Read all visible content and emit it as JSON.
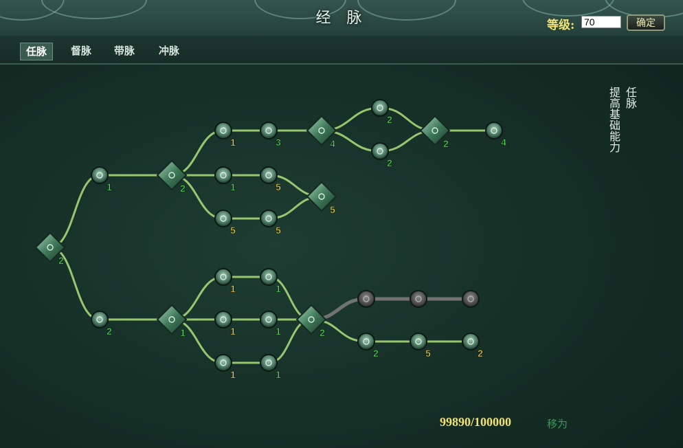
{
  "window": {
    "title": "经 脉"
  },
  "level": {
    "label": "等级:",
    "value": "70",
    "confirm": "确定"
  },
  "tabs": [
    {
      "label": "任脉",
      "active": true
    },
    {
      "label": "督脉",
      "active": false
    },
    {
      "label": "带脉",
      "active": false
    },
    {
      "label": "冲脉",
      "active": false
    }
  ],
  "description": {
    "line1": "任脉",
    "line2": "提高基础能力"
  },
  "points": {
    "current": "99890/100000",
    "action": "移为"
  },
  "colors": {
    "path_active": "#aee07a",
    "path_locked": "#7a7a7a",
    "num_green": "#4fe04f",
    "num_yellow": "#f4d63a"
  },
  "tree": {
    "nodes": [
      {
        "id": "root",
        "shape": "diamond",
        "icon": "diamond-gem-icon",
        "level": "2",
        "color": "green",
        "state": "active"
      },
      {
        "id": "u1",
        "shape": "circle",
        "icon": "gem-icon",
        "level": "1",
        "color": "green",
        "state": "active"
      },
      {
        "id": "u2",
        "shape": "diamond",
        "icon": "flame-icon",
        "level": "2",
        "color": "green",
        "state": "active"
      },
      {
        "id": "a1",
        "shape": "circle",
        "icon": "claw-icon",
        "level": "1",
        "color": "yellow",
        "state": "active"
      },
      {
        "id": "a2",
        "shape": "circle",
        "icon": "leaf-icon",
        "level": "3",
        "color": "green",
        "state": "active"
      },
      {
        "id": "a3",
        "shape": "diamond",
        "icon": "scroll-icon",
        "level": "4",
        "color": "green",
        "state": "active"
      },
      {
        "id": "a4",
        "shape": "circle",
        "icon": "leaf-icon",
        "level": "2",
        "color": "green",
        "state": "active"
      },
      {
        "id": "a5",
        "shape": "circle",
        "icon": "leaf-icon",
        "level": "2",
        "color": "green",
        "state": "active"
      },
      {
        "id": "a6",
        "shape": "diamond",
        "icon": "gem-icon",
        "level": "2",
        "color": "green",
        "state": "active"
      },
      {
        "id": "a7",
        "shape": "circle",
        "icon": "leaf-icon",
        "level": "4",
        "color": "green",
        "state": "active"
      },
      {
        "id": "b1",
        "shape": "circle",
        "icon": "spiral-icon",
        "level": "1",
        "color": "green",
        "state": "active"
      },
      {
        "id": "b2",
        "shape": "circle",
        "icon": "boot-icon",
        "level": "5",
        "color": "yellow",
        "state": "active"
      },
      {
        "id": "b3",
        "shape": "diamond",
        "icon": "shield-icon",
        "level": "5",
        "color": "yellow",
        "state": "active"
      },
      {
        "id": "c1",
        "shape": "circle",
        "icon": "shield-icon",
        "level": "5",
        "color": "yellow",
        "state": "active"
      },
      {
        "id": "c2",
        "shape": "circle",
        "icon": "leaf-icon",
        "level": "5",
        "color": "yellow",
        "state": "active"
      },
      {
        "id": "l1",
        "shape": "circle",
        "icon": "fist-icon",
        "level": "2",
        "color": "green",
        "state": "active"
      },
      {
        "id": "l2",
        "shape": "diamond",
        "icon": "dragon-icon",
        "level": "1",
        "color": "green",
        "state": "active"
      },
      {
        "id": "d1",
        "shape": "circle",
        "icon": "shield-icon",
        "level": "1",
        "color": "yellow",
        "state": "active"
      },
      {
        "id": "d2",
        "shape": "circle",
        "icon": "leaf-icon",
        "level": "1",
        "color": "green",
        "state": "active"
      },
      {
        "id": "e1",
        "shape": "circle",
        "icon": "spiral-icon",
        "level": "1",
        "color": "yellow",
        "state": "active"
      },
      {
        "id": "e2",
        "shape": "circle",
        "icon": "leaf-icon",
        "level": "1",
        "color": "green",
        "state": "active"
      },
      {
        "id": "f1",
        "shape": "circle",
        "icon": "boot-icon",
        "level": "1",
        "color": "yellow",
        "state": "active"
      },
      {
        "id": "f2",
        "shape": "circle",
        "icon": "leaf-icon",
        "level": "1",
        "color": "green",
        "state": "active"
      },
      {
        "id": "m1",
        "shape": "diamond",
        "icon": "hand-icon",
        "level": "2",
        "color": "green",
        "state": "active"
      },
      {
        "id": "g1",
        "shape": "circle",
        "icon": "spiral-icon",
        "level": "",
        "color": "green",
        "state": "locked"
      },
      {
        "id": "g2",
        "shape": "circle",
        "icon": "leaf-icon",
        "level": "",
        "color": "green",
        "state": "locked"
      },
      {
        "id": "g3",
        "shape": "circle",
        "icon": "leaf-icon",
        "level": "",
        "color": "green",
        "state": "locked"
      },
      {
        "id": "h1",
        "shape": "circle",
        "icon": "leaf-icon",
        "level": "2",
        "color": "green",
        "state": "active"
      },
      {
        "id": "h2",
        "shape": "circle",
        "icon": "leaf-icon",
        "level": "5",
        "color": "yellow",
        "state": "active"
      },
      {
        "id": "h3",
        "shape": "circle",
        "icon": "claw-icon",
        "level": "2",
        "color": "yellow",
        "state": "active"
      }
    ],
    "edges": [
      [
        "root",
        "u1"
      ],
      [
        "root",
        "l1"
      ],
      [
        "u1",
        "u2"
      ],
      [
        "u2",
        "a1"
      ],
      [
        "a1",
        "a2"
      ],
      [
        "a2",
        "a3"
      ],
      [
        "a3",
        "a4"
      ],
      [
        "a3",
        "a5"
      ],
      [
        "a4",
        "a6"
      ],
      [
        "a5",
        "a6"
      ],
      [
        "a6",
        "a7"
      ],
      [
        "u2",
        "b1"
      ],
      [
        "b1",
        "b2"
      ],
      [
        "b2",
        "b3"
      ],
      [
        "u2",
        "c1"
      ],
      [
        "c1",
        "c2"
      ],
      [
        "c2",
        "b3"
      ],
      [
        "l1",
        "l2"
      ],
      [
        "l2",
        "d1"
      ],
      [
        "d1",
        "d2"
      ],
      [
        "l2",
        "e1"
      ],
      [
        "e1",
        "e2"
      ],
      [
        "l2",
        "f1"
      ],
      [
        "f1",
        "f2"
      ],
      [
        "d2",
        "m1"
      ],
      [
        "e2",
        "m1"
      ],
      [
        "f2",
        "m1"
      ],
      [
        "m1",
        "g1"
      ],
      [
        "g1",
        "g2"
      ],
      [
        "g2",
        "g3"
      ],
      [
        "m1",
        "h1"
      ],
      [
        "h1",
        "h2"
      ],
      [
        "h2",
        "h3"
      ]
    ]
  }
}
